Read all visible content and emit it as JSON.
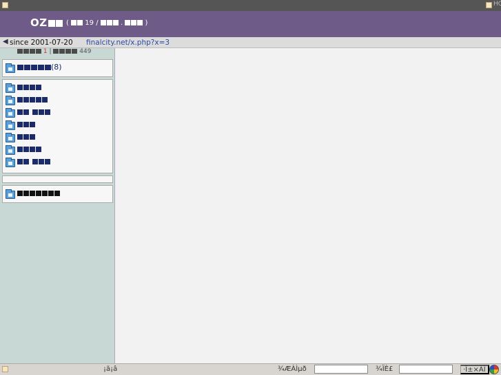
{
  "topbar": {
    "right_label": "HC"
  },
  "header": {
    "logo_prefix": "OZ",
    "sub_open": "(",
    "sub_number": "19",
    "sub_slash": "/",
    "sub_dot": ".",
    "sub_close": ")"
  },
  "infobar": {
    "arrow": "◀",
    "since": "since 2001-07-20",
    "url": "finalcity.net/x.php?x=3"
  },
  "counter": {
    "today": "1",
    "separator": "|",
    "total": "449"
  },
  "sidebar": {
    "top_item": {
      "count": "(8)"
    },
    "items": [
      {
        "blocks": [
          4
        ]
      },
      {
        "blocks": [
          5
        ]
      },
      {
        "blocks": [
          2,
          3
        ]
      },
      {
        "blocks": [
          3
        ]
      },
      {
        "blocks": [
          3
        ]
      },
      {
        "blocks": [
          4
        ]
      },
      {
        "blocks": [
          2,
          3
        ]
      }
    ],
    "bottom_item": {
      "blocks": [
        7
      ]
    }
  },
  "statusbar": {
    "left_text": "¡ã¡â",
    "label1": "¾ÆÀÌµð",
    "label2": "¾ÏÈ£",
    "input1_value": "",
    "input2_value": "",
    "button_label": "·Î±×ÀÎ"
  },
  "colors": {
    "header_bg": "#6e5b87",
    "sidebar_bg": "#c8d8d4",
    "link": "#2b4aa0"
  }
}
